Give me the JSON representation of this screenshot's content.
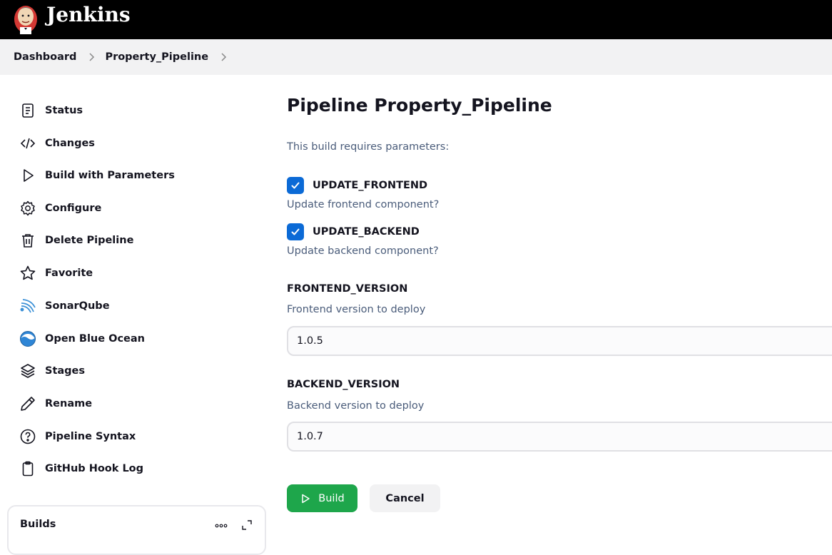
{
  "header": {
    "brand": "Jenkins",
    "logo_icon": "jenkins-butler-logo"
  },
  "breadcrumb": {
    "items": [
      "Dashboard",
      "Property_Pipeline"
    ]
  },
  "sidebar": {
    "items": [
      {
        "label": "Status",
        "icon": "document-icon"
      },
      {
        "label": "Changes",
        "icon": "code-icon"
      },
      {
        "label": "Build with Parameters",
        "icon": "play-icon"
      },
      {
        "label": "Configure",
        "icon": "gear-icon"
      },
      {
        "label": "Delete Pipeline",
        "icon": "trash-icon"
      },
      {
        "label": "Favorite",
        "icon": "star-icon"
      },
      {
        "label": "SonarQube",
        "icon": "sonarqube-icon"
      },
      {
        "label": "Open Blue Ocean",
        "icon": "blue-ocean-icon"
      },
      {
        "label": "Stages",
        "icon": "layers-icon"
      },
      {
        "label": "Rename",
        "icon": "pencil-icon"
      },
      {
        "label": "Pipeline Syntax",
        "icon": "help-icon"
      },
      {
        "label": "GitHub Hook Log",
        "icon": "clipboard-icon"
      }
    ],
    "builds": {
      "title": "Builds"
    }
  },
  "main": {
    "title": "Pipeline Property_Pipeline",
    "requires_text": "This build requires parameters:",
    "params": {
      "update_frontend": {
        "name": "UPDATE_FRONTEND",
        "checked": true,
        "description": "Update frontend component?"
      },
      "update_backend": {
        "name": "UPDATE_BACKEND",
        "checked": true,
        "description": "Update backend component?"
      },
      "frontend_version": {
        "name": "FRONTEND_VERSION",
        "description": "Frontend version to deploy",
        "value": "1.0.5"
      },
      "backend_version": {
        "name": "BACKEND_VERSION",
        "description": "Backend version to deploy",
        "value": "1.0.7"
      }
    },
    "build_label": "Build",
    "cancel_label": "Cancel"
  },
  "colors": {
    "header_bg": "#000000",
    "breadcrumb_bg": "#f2f2f3",
    "accent_blue": "#0b6ad6",
    "build_green": "#1ea64b",
    "description_text": "#4a5c7a"
  }
}
